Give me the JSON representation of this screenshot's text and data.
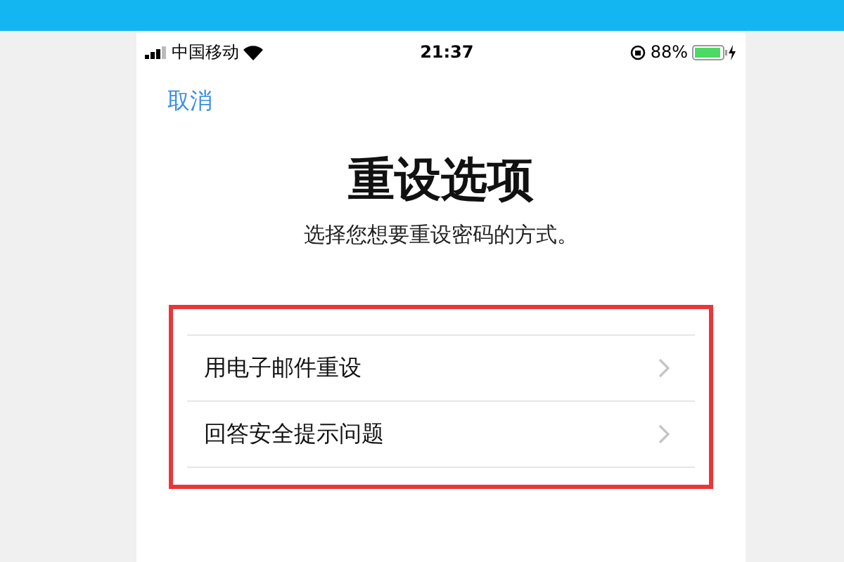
{
  "status_bar": {
    "carrier": "中国移动",
    "time": "21:37",
    "battery_percent": "88%"
  },
  "nav": {
    "cancel": "取消"
  },
  "title": "重设选项",
  "subtitle": "选择您想要重设密码的方式。",
  "options": [
    {
      "label": "用电子邮件重设"
    },
    {
      "label": "回答安全提示问题"
    }
  ]
}
